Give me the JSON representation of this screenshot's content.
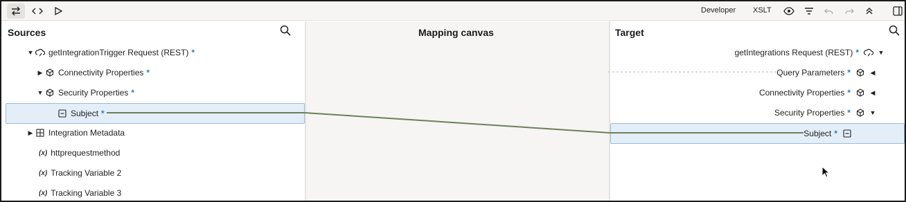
{
  "toolbar": {
    "mode_developer": "Developer",
    "mode_xslt": "XSLT",
    "icons": [
      "swap-icon",
      "code-icon",
      "play-icon",
      "eye-icon",
      "filter-icon",
      "undo-icon",
      "redo-icon",
      "collapse-up-icon",
      "panel-toggle-icon"
    ]
  },
  "sources": {
    "title": "Sources",
    "items": [
      {
        "label": "getIntegrationTrigger Request (REST)",
        "star": "*",
        "icon": "rest-trigger-icon",
        "expanded": true
      },
      {
        "label": "Connectivity Properties",
        "star": "*",
        "icon": "cube-icon",
        "expanded": false
      },
      {
        "label": "Security Properties",
        "star": "*",
        "icon": "cube-icon",
        "expanded": true
      },
      {
        "label": "Subject",
        "star": "*",
        "icon": "element-icon",
        "selected": true
      },
      {
        "label": "Integration Metadata",
        "icon": "grid-icon",
        "expanded": false
      },
      {
        "label": "httprequestmethod",
        "icon": "variable-icon",
        "prefix": "(x)"
      },
      {
        "label": "Tracking Variable 2",
        "icon": "variable-icon",
        "prefix": "(x)"
      },
      {
        "label": "Tracking Variable 3",
        "icon": "variable-icon",
        "prefix": "(x)"
      }
    ]
  },
  "canvas": {
    "title": "Mapping canvas"
  },
  "target": {
    "title": "Target",
    "items": [
      {
        "label": "getIntegrations Request (REST)",
        "star": "*",
        "icon": "rest-trigger-icon",
        "expanded": true
      },
      {
        "label": "Query Parameters",
        "star": "*",
        "icon": "cube-icon",
        "expanded": false
      },
      {
        "label": "Connectivity Properties",
        "star": "*",
        "icon": "cube-icon",
        "expanded": false
      },
      {
        "label": "Security Properties",
        "star": "*",
        "icon": "cube-icon",
        "expanded": true
      },
      {
        "label": "Subject",
        "star": "*",
        "icon": "element-icon",
        "selected": true
      }
    ]
  },
  "colors": {
    "mapping_line": "#6b7f5a",
    "selection_fill": "#e3eef8",
    "required_star": "#2b7fb8"
  }
}
